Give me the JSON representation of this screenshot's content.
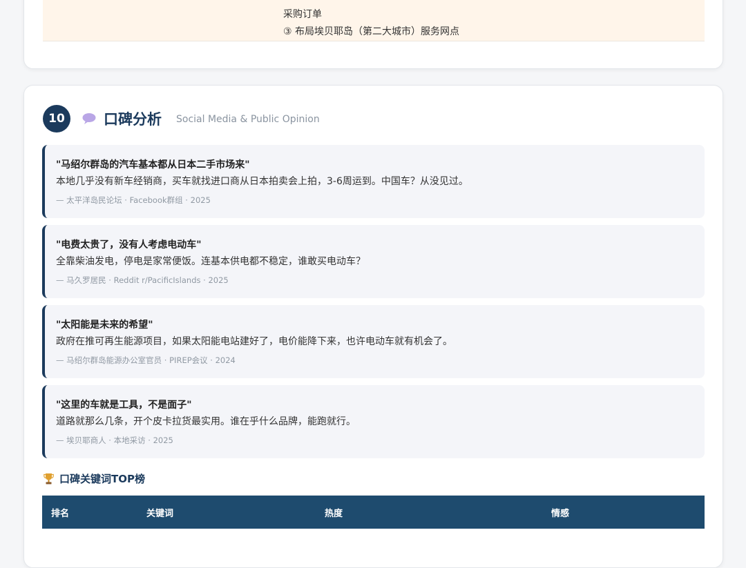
{
  "order": {
    "line1": "采购订单",
    "line2": "③ 布局埃贝耶岛（第二大城市）服务网点"
  },
  "section": {
    "number": "10",
    "title": "口碑分析",
    "subtitle": "Social Media & Public Opinion"
  },
  "quotes": [
    {
      "title": "\"马绍尔群岛的汽车基本都从日本二手市场来\"",
      "body": "本地几乎没有新车经销商，买车就找进口商从日本拍卖会上拍，3-6周运到。中国车？从没见过。",
      "source": "— 太平洋岛民论坛 · Facebook群组 · 2025"
    },
    {
      "title": "\"电费太贵了，没有人考虑电动车\"",
      "body": "全靠柴油发电，停电是家常便饭。连基本供电都不稳定，谁敢买电动车？",
      "source": "— 马久罗居民 · Reddit r/PacificIslands · 2025"
    },
    {
      "title": "\"太阳能是未来的希望\"",
      "body": "政府在推可再生能源项目，如果太阳能电站建好了，电价能降下来，也许电动车就有机会了。",
      "source": "— 马绍尔群岛能源办公室官员 · PIREP会议 · 2024"
    },
    {
      "title": "\"这里的车就是工具，不是面子\"",
      "body": "道路就那么几条，开个皮卡拉货最实用。谁在乎什么品牌，能跑就行。",
      "source": "— 埃贝耶商人 · 本地采访 · 2025"
    }
  ],
  "ranking": {
    "title": "口碑关键词TOP榜",
    "columns": [
      "排名",
      "关键词",
      "热度",
      "情感"
    ]
  },
  "colors": {
    "navy": "#1b3a5c",
    "table_header": "#1e4b6e",
    "order_bg": "#fff5ea",
    "quote_bg": "#f4f5f9"
  },
  "icons": {
    "section": "speech-bubble-icon",
    "ranking": "trophy-icon"
  }
}
